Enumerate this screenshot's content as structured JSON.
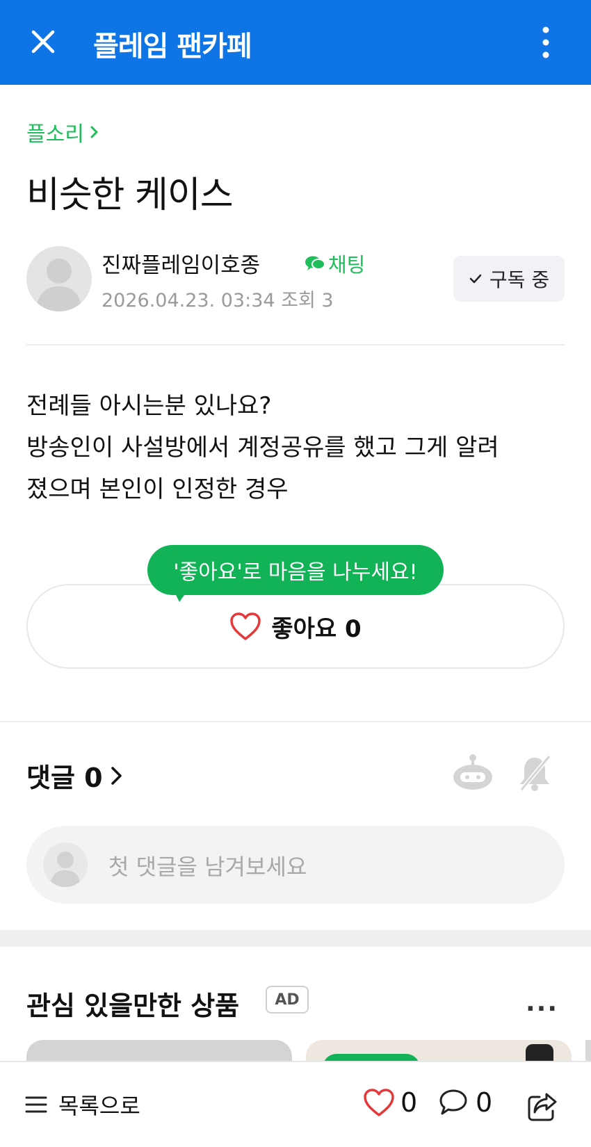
{
  "appbar": {
    "title": "플레임 팬카페"
  },
  "post": {
    "category": "플소리",
    "title": "비슷한 케이스",
    "author": "진짜플레임이호종",
    "chat_label": "채팅",
    "date": "2026.04.23. 03:34",
    "views": "조회 3",
    "subscribe_label": "구독 중",
    "body_lines": [
      "전례들 아시는분 있나요?",
      "방송인이 사설방에서 계정공유를 했고 그게 알려",
      "졌으며 본인이 인정한 경우"
    ]
  },
  "like": {
    "tooltip": "'좋아요'로 마음을 나누세요!",
    "label": "좋아요 0",
    "color": "#12b356"
  },
  "comments": {
    "header": "댓글 0",
    "placeholder": "첫 댓글을 남겨보세요"
  },
  "recommend": {
    "title": "관심 있을만한 상품",
    "badge": "AD",
    "more": "..."
  },
  "bottom": {
    "list_label": "목록으로",
    "like_count": "0",
    "comment_count": "0"
  },
  "colors": {
    "appbar": "#0f75e6",
    "accent_green": "#1ebe5a",
    "heart_red": "#e5383b"
  },
  "icons": [
    "close-icon",
    "more-vertical-icon",
    "chevron-right-icon",
    "chat-bubbles-icon",
    "check-icon",
    "heart-icon",
    "bot-icon",
    "bell-off-icon",
    "menu-icon",
    "comment-icon",
    "share-icon"
  ]
}
